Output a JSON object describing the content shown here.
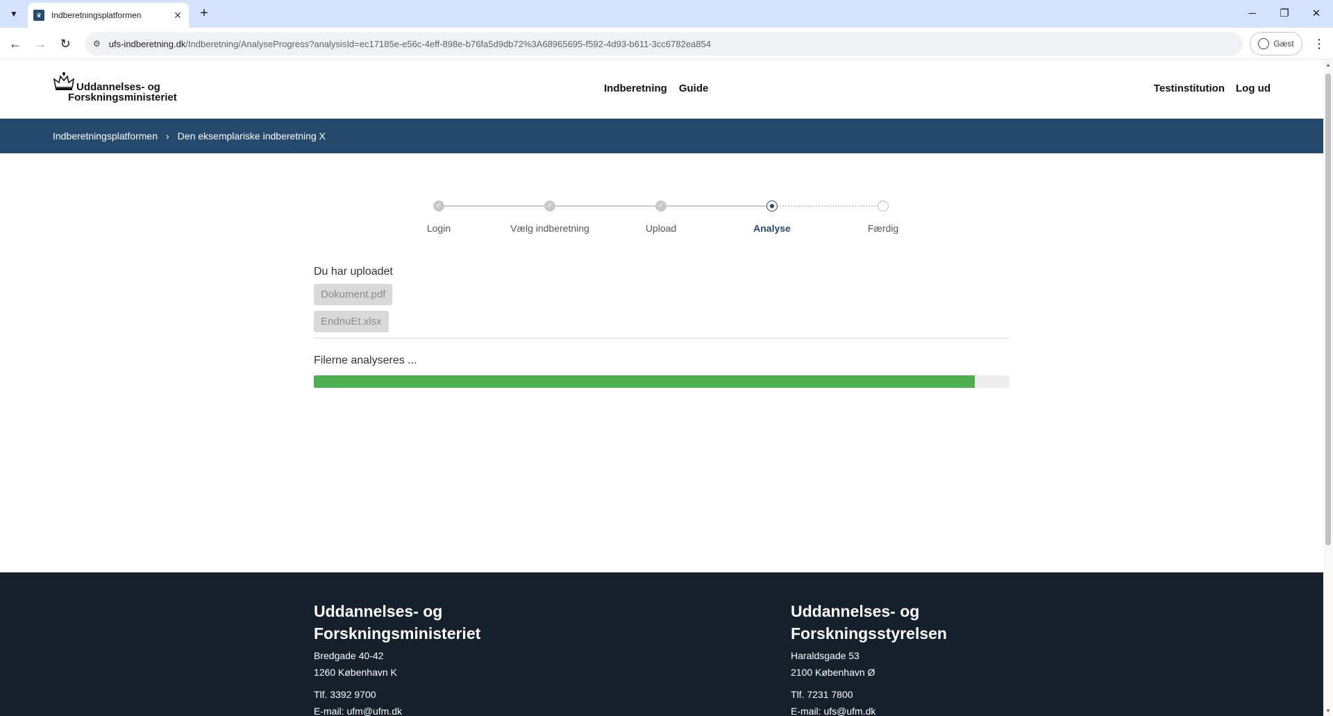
{
  "browser": {
    "tab_title": "Indberetningsplatformen",
    "url_domain": "ufs-indberetning.dk",
    "url_path": "/Indberetning/AnalyseProgress?analysisId=ec17185e-e56c-4eff-898e-b76fa5d9db72%3A68965695-f592-4d93-b611-3cc6782ea854",
    "profile_label": "Gæst"
  },
  "header": {
    "logo_line1": "Uddannelses- og",
    "logo_line2": "Forskningsministeriet",
    "nav": [
      "Indberetning",
      "Guide"
    ],
    "right_nav": [
      "Testinstitution",
      "Log ud"
    ]
  },
  "breadcrumb": [
    "Indberetningsplatformen",
    "Den eksemplariske indberetning X"
  ],
  "stepper": {
    "steps": [
      "Login",
      "Vælg indberetning",
      "Upload",
      "Analyse",
      "Færdig"
    ],
    "current_index": 3
  },
  "upload": {
    "title": "Du har uploadet",
    "files": [
      "Dokument.pdf",
      "EndnuEt.xlsx"
    ],
    "status_text": "Filerne analyseres ...",
    "progress": 0.95
  },
  "footer": {
    "col1": {
      "name_line1": "Uddannelses- og",
      "name_line2": "Forskningsministeriet",
      "address1": "Bredgade 40-42",
      "address2": "1260 København K",
      "phone": "Tlf. 3392 9700",
      "email": "E-mail: ufm@ufm.dk"
    },
    "col2": {
      "name_line1": "Uddannelses- og",
      "name_line2": "Forskningsstyrelsen",
      "address1": "Haraldsgade 53",
      "address2": "2100 København Ø",
      "phone": "Tlf. 7231 7800",
      "email": "E-mail: ufs@ufm.dk"
    }
  },
  "colors": {
    "brand": "#264a6e",
    "progress": "#4caf50",
    "footer_bg": "#15202b"
  }
}
